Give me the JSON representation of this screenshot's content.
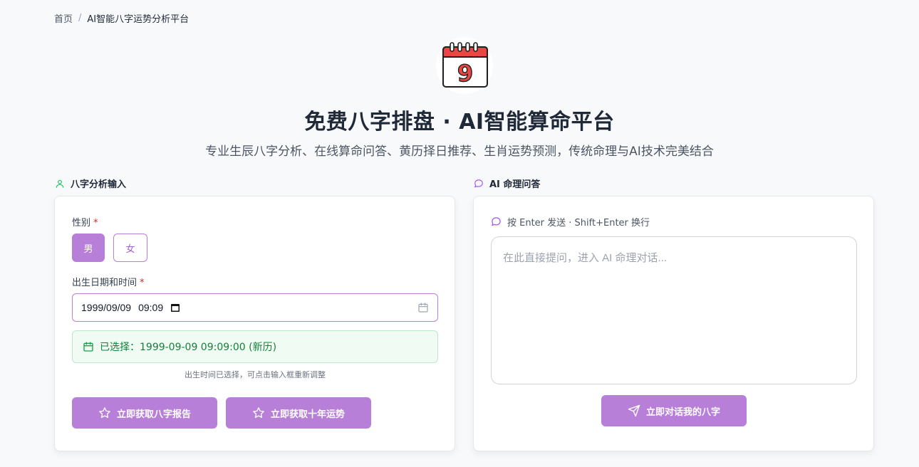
{
  "breadcrumb": {
    "home": "首页",
    "separator": "/",
    "current": "AI智能八字运势分析平台"
  },
  "logo": {
    "icon": "calendar-icon",
    "number": "9"
  },
  "hero": {
    "title": "免费八字排盘 · AI智能算命平台",
    "subtitle": "专业生辰八字分析、在线算命问答、黄历择日推荐、生肖运势预测，传统命理与AI技术完美结合"
  },
  "input_section": {
    "heading": "八字分析输入",
    "icon": "user-icon",
    "gender_label": "性别",
    "required_mark": "*",
    "gender_options": [
      "男",
      "女"
    ],
    "gender_selected": "男",
    "birth_label": "出生日期和时间",
    "birth_value_date": "1999/09/09",
    "birth_value_time": "09:09",
    "selected_text": "已选择：1999-09-09 09:09:00 (新历)",
    "hint": "出生时间已选择，可点击输入框重新调整",
    "btn_report": "立即获取八字报告",
    "btn_decade": "立即获取十年运势"
  },
  "chat_section": {
    "heading": "AI 命理问答",
    "icon": "chat-bubble-icon",
    "hint": "按 Enter 发送 · Shift+Enter 换行",
    "placeholder": "在此直接提问，进入 AI 命理对话...",
    "send_button": "立即对话我的八字"
  },
  "colors": {
    "accent": "#b87fd9",
    "success_bg": "#effbf3",
    "success_text": "#15803d",
    "required": "#dc2626"
  }
}
